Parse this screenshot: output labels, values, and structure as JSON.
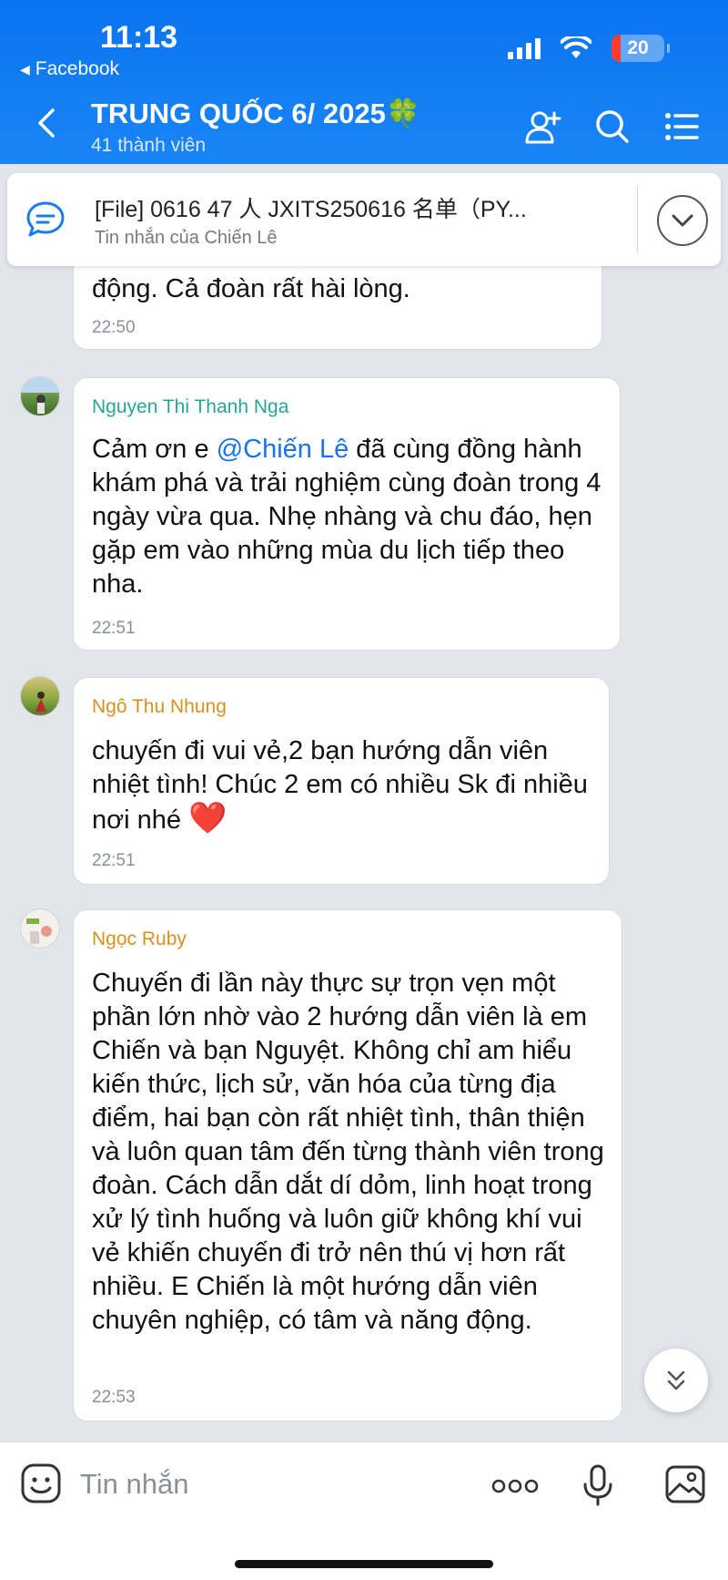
{
  "status_bar": {
    "time": "11:13",
    "back_app": "Facebook",
    "battery": "20"
  },
  "header": {
    "title": "TRUNG QUỐC 6/ 2025🍀",
    "subtitle": "41 thành viên"
  },
  "pinned": {
    "title": "[File] 0616   47 人    JXITS250616 名单（PY...",
    "subtitle": "Tin nhắn của Chiến Lê"
  },
  "messages": [
    {
      "sender": "",
      "text": "động. Cả đoàn rất hài lòng.",
      "time": "22:50"
    },
    {
      "sender": "Nguyen Thi Thanh Nga",
      "sender_color": "#26a69a",
      "text_before": "Cảm ơn e ",
      "mention": "@Chiến Lê",
      "text_after": " đã cùng đồng hành khám phá và trải nghiệm cùng đoàn trong 4 ngày vừa qua. Nhẹ nhàng và chu đáo, hẹn gặp em vào những mùa du lịch tiếp theo nha.",
      "time": "22:51"
    },
    {
      "sender": "Ngô Thu Nhung",
      "sender_color": "#d4921f",
      "text": "chuyến đi vui vẻ,2 bạn hướng dẫn viên nhiệt tình! Chúc 2 em có nhiều Sk đi nhiều nơi nhé",
      "emoji": "❤️",
      "time": "22:51"
    },
    {
      "sender": "Ngọc Ruby",
      "sender_color": "#d4921f",
      "text": "Chuyến đi lần này thực sự trọn vẹn một phần lớn nhờ vào 2 hướng dẫn viên là em Chiến và bạn Nguyệt. Không chỉ am hiểu kiến thức, lịch sử, văn hóa của từng địa điểm, hai bạn còn rất nhiệt tình, thân thiện và luôn quan tâm đến từng thành viên trong đoàn. Cách dẫn dắt dí dỏm, linh hoạt trong xử lý tình huống và luôn giữ không khí vui vẻ khiến chuyến đi trở nên thú vị hơn rất nhiều. E Chiến là một hướng dẫn viên chuyên nghiệp, có tâm và năng động.",
      "time": "22:53"
    }
  ],
  "composer": {
    "placeholder": "Tin nhắn"
  },
  "icons": {
    "back": "chevron-left-icon",
    "add_member": "add-member-icon",
    "search": "search-icon",
    "menu": "list-menu-icon",
    "pinned": "chat-bubble-icon",
    "expand": "chevron-down-icon",
    "emoji": "emoji-icon",
    "more": "more-dots-icon",
    "mic": "microphone-icon",
    "image": "image-icon",
    "scroll_down": "double-chevron-down-icon"
  }
}
